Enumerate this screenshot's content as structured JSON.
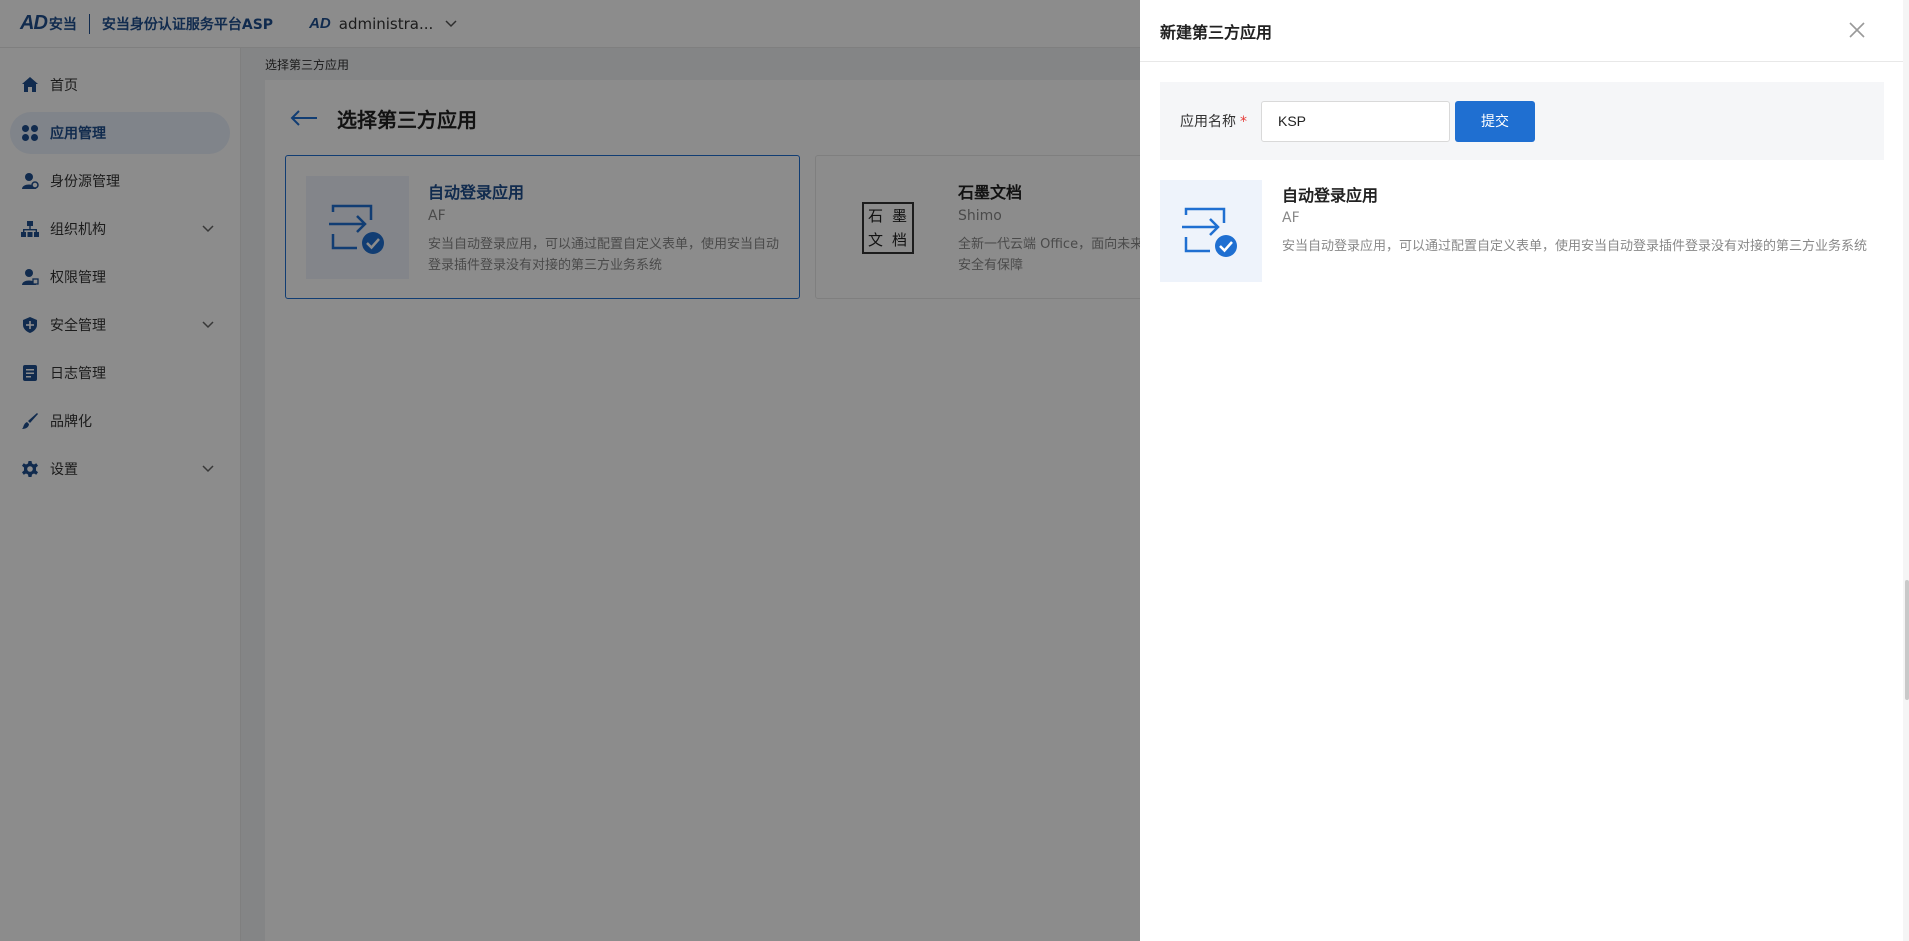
{
  "header": {
    "logo_mark": "AD",
    "logo_cn": "安当",
    "platform_name": "安当身份认证服务平台ASP",
    "tenant_mark": "AD",
    "tenant_name": "administra..."
  },
  "sidebar": {
    "items": [
      {
        "label": "首页",
        "icon": "home-icon"
      },
      {
        "label": "应用管理",
        "icon": "apps-icon",
        "active": true
      },
      {
        "label": "身份源管理",
        "icon": "user-source-icon"
      },
      {
        "label": "组织机构",
        "icon": "org-tree-icon",
        "expandable": true
      },
      {
        "label": "权限管理",
        "icon": "permission-icon"
      },
      {
        "label": "安全管理",
        "icon": "shield-icon",
        "expandable": true
      },
      {
        "label": "日志管理",
        "icon": "log-icon"
      },
      {
        "label": "品牌化",
        "icon": "brand-icon"
      },
      {
        "label": "设置",
        "icon": "gear-icon",
        "expandable": true
      }
    ]
  },
  "main": {
    "breadcrumb": "选择第三方应用",
    "title": "选择第三方应用",
    "cards": [
      {
        "title": "自动登录应用",
        "code": "AF",
        "desc": "安当自动登录应用，可以通过配置自定义表单，使用安当自动登录插件登录没有对接的第三方业务系统",
        "selected": true
      },
      {
        "title": "石墨文档",
        "code": "Shimo",
        "desc": "全新一代云端 Office，面向未来的协同·知识沉淀管理 · 数据安全有保障",
        "logo": [
          "石",
          "墨",
          "文",
          "档"
        ]
      }
    ]
  },
  "drawer": {
    "title": "新建第三方应用",
    "form": {
      "label": "应用名称",
      "required_mark": "*",
      "value": "KSP",
      "submit_label": "提交"
    },
    "app": {
      "title": "自动登录应用",
      "code": "AF",
      "desc": "安当自动登录应用，可以通过配置自定义表单，使用安当自动登录插件登录没有对接的第三方业务系统"
    }
  },
  "colors": {
    "brand": "#1f4f8f",
    "primary": "#1f6fd1",
    "active_bg": "#e9f0fb",
    "thumb_bg": "#eef3fb"
  }
}
